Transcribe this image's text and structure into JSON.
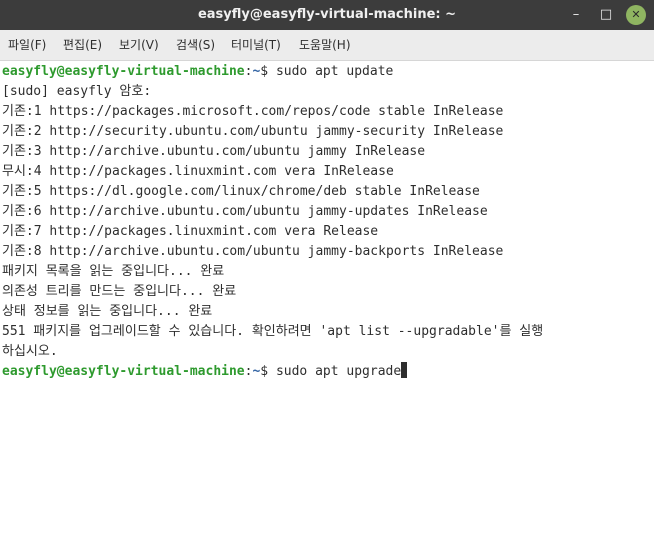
{
  "window": {
    "title": "easyfly@easyfly-virtual-machine: ~",
    "minimize_label": "–",
    "maximize_label": "□",
    "close_label": "✕"
  },
  "menu": {
    "items": [
      {
        "label": "파일(F)"
      },
      {
        "label": "편집(E)"
      },
      {
        "label": "보기(V)"
      },
      {
        "label": "검색(S)"
      },
      {
        "label": "터미널(T)"
      },
      {
        "label": "도움말(H)"
      }
    ]
  },
  "terminal": {
    "prompt": {
      "user_host": "easyfly@easyfly-virtual-machine",
      "path": "~",
      "symbol": "$ "
    },
    "command1": "sudo apt update",
    "output": [
      "[sudo] easyfly 암호:",
      "기존:1 https://packages.microsoft.com/repos/code stable InRelease",
      "기존:2 http://security.ubuntu.com/ubuntu jammy-security InRelease",
      "기존:3 http://archive.ubuntu.com/ubuntu jammy InRelease",
      "무시:4 http://packages.linuxmint.com vera InRelease",
      "기존:5 https://dl.google.com/linux/chrome/deb stable InRelease",
      "기존:6 http://archive.ubuntu.com/ubuntu jammy-updates InRelease",
      "기존:7 http://packages.linuxmint.com vera Release",
      "기존:8 http://archive.ubuntu.com/ubuntu jammy-backports InRelease",
      "패키지 목록을 읽는 중입니다... 완료",
      "의존성 트리를 만드는 중입니다... 완료",
      "상태 정보를 읽는 중입니다... 완료",
      "551 패키지를 업그레이드할 수 있습니다. 확인하려면 'apt list --upgradable'를 실행",
      "하십시오."
    ],
    "command2": "sudo apt upgrade"
  },
  "colors": {
    "titlebar": "#3c3c3c",
    "menubar": "#ececec",
    "prompt_user": "#2e9a2e",
    "prompt_path": "#3465a4",
    "close_button": "#8fb561"
  }
}
